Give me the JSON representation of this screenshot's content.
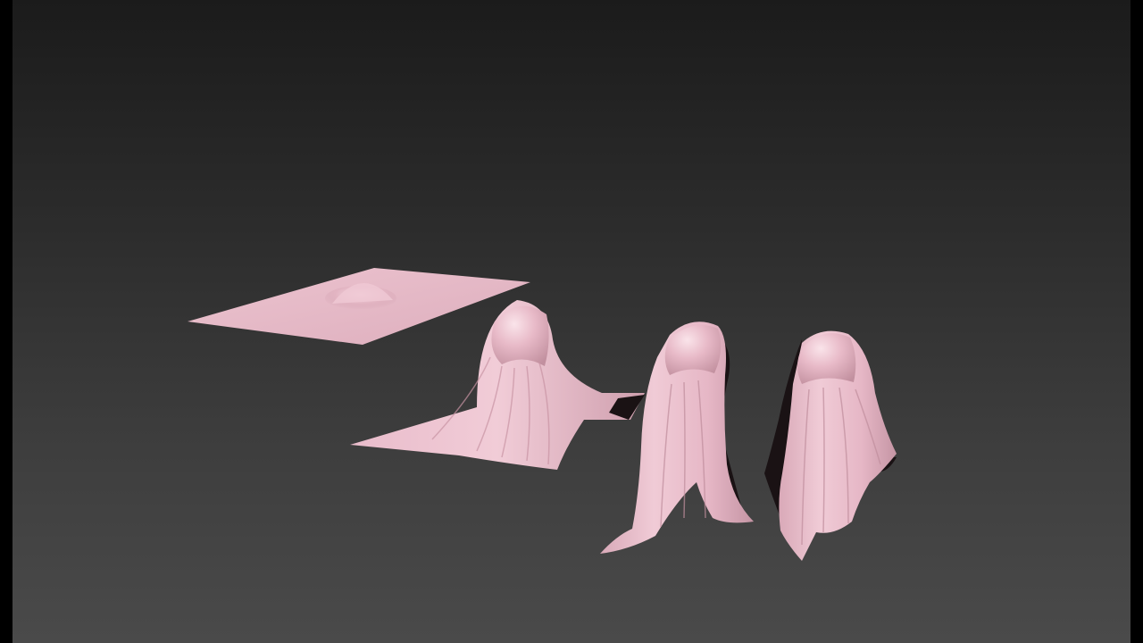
{
  "viewport": {
    "background_top": "#1b1b1b",
    "background_bottom": "#4a4a4a",
    "letterbox_color": "#000000"
  },
  "scene": {
    "cloth_color": "#e7b9c7",
    "cloth_shadow_color": "#b58a98",
    "cloth_backface_color": "#1a1214",
    "objects": [
      {
        "id": "flat-cloth-plane",
        "state": "flat sheet with small bump"
      },
      {
        "id": "draped-cloth-on-ground",
        "state": "draped over sphere, spread on floor"
      },
      {
        "id": "hanging-cloth-ghost-1",
        "state": "hanging cloth over sphere"
      },
      {
        "id": "hanging-cloth-ghost-2",
        "state": "hanging cloth over sphere"
      }
    ]
  }
}
